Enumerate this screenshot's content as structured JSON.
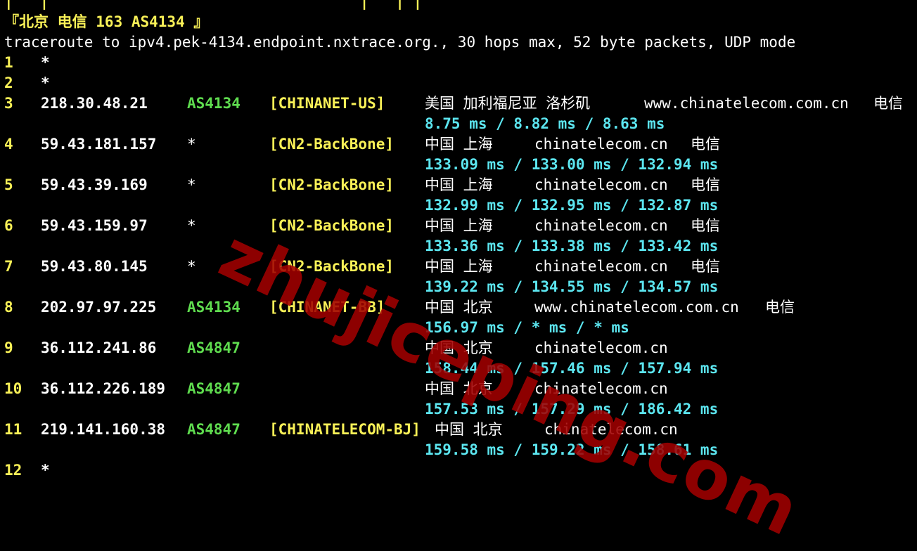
{
  "header": {
    "prev_fragment": "|   |                                   |   | |",
    "title": "『北京 电信 163 AS4134 』"
  },
  "command": "traceroute to ipv4.pek-4134.endpoint.nxtrace.org., 30 hops max, 52 byte packets, UDP mode",
  "watermark": "zhujiceping.com",
  "hops": [
    {
      "n": "1",
      "ip": "*",
      "as": "",
      "tag": "",
      "geo": "",
      "domain": "",
      "isp": "",
      "lat": ""
    },
    {
      "n": "2",
      "ip": "*",
      "as": "",
      "tag": "",
      "geo": "",
      "domain": "",
      "isp": "",
      "lat": ""
    },
    {
      "n": "3",
      "ip": "218.30.48.21",
      "as": "AS4134",
      "tag": "[CHINANET-US]",
      "geo": "美国 加利福尼亚 洛杉矶",
      "domain": "www.chinatelecom.com.cn",
      "isp": "电信",
      "lat": "8.75 ms / 8.82 ms / 8.63 ms"
    },
    {
      "n": "4",
      "ip": "59.43.181.157",
      "as": "*",
      "tag": "[CN2-BackBone]",
      "geo": "中国 上海",
      "domain": "chinatelecom.cn",
      "isp": "电信",
      "lat": "133.09 ms / 133.00 ms / 132.94 ms"
    },
    {
      "n": "5",
      "ip": "59.43.39.169",
      "as": "*",
      "tag": "[CN2-BackBone]",
      "geo": "中国 上海",
      "domain": "chinatelecom.cn",
      "isp": "电信",
      "lat": "132.99 ms / 132.95 ms / 132.87 ms"
    },
    {
      "n": "6",
      "ip": "59.43.159.97",
      "as": "*",
      "tag": "[CN2-BackBone]",
      "geo": "中国 上海",
      "domain": "chinatelecom.cn",
      "isp": "电信",
      "lat": "133.36 ms / 133.38 ms / 133.42 ms"
    },
    {
      "n": "7",
      "ip": "59.43.80.145",
      "as": "*",
      "tag": "[CN2-BackBone]",
      "geo": "中国 上海",
      "domain": "chinatelecom.cn",
      "isp": "电信",
      "lat": "139.22 ms / 134.55 ms / 134.57 ms"
    },
    {
      "n": "8",
      "ip": "202.97.97.225",
      "as": "AS4134",
      "tag": "[CHINANET-BB]",
      "geo": "中国 北京",
      "domain": "www.chinatelecom.com.cn",
      "isp": "电信",
      "lat": "156.97 ms / * ms / * ms"
    },
    {
      "n": "9",
      "ip": "36.112.241.86",
      "as": "AS4847",
      "tag": "",
      "geo": "中国 北京",
      "domain": "chinatelecom.cn",
      "isp": "",
      "lat": "158.44 ms / 157.46 ms / 157.94 ms"
    },
    {
      "n": "10",
      "ip": "36.112.226.189",
      "as": "AS4847",
      "tag": "",
      "geo": "中国 北京",
      "domain": "chinatelecom.cn",
      "isp": "",
      "lat": "157.53 ms / 157.29 ms / 186.42 ms"
    },
    {
      "n": "11",
      "ip": "219.141.160.38",
      "as": "AS4847",
      "tag": "[CHINATELECOM-BJ]",
      "geo": "中国 北京",
      "domain": "chinatelecom.cn",
      "isp": "",
      "lat": "159.58 ms / 159.22 ms / 158.61 ms"
    },
    {
      "n": "12",
      "ip": "*",
      "as": "",
      "tag": "",
      "geo": "",
      "domain": "",
      "isp": "",
      "lat": ""
    }
  ],
  "colors": {
    "background": "#000000",
    "text": "#ffffff",
    "hop_number": "#f9f157",
    "asn": "#5fdc4f",
    "latency": "#5ce6f0",
    "tag": "#f9f157"
  }
}
